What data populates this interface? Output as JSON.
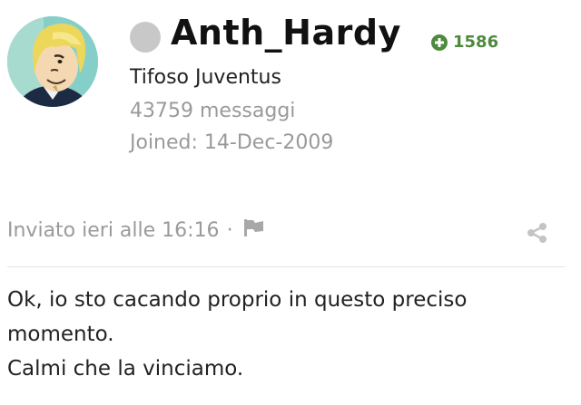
{
  "author": {
    "username": "Anth_Hardy",
    "reputation": "1586",
    "title": "Tifoso Juventus",
    "post_count": "43759 messaggi",
    "joined": "Joined: 14-Dec-2009",
    "avatar_icon": "avatar-image",
    "status_icon": "offline-status-icon",
    "reputation_icon": "plus-circle-icon"
  },
  "post": {
    "sent_text": "Inviato ieri alle 16:16",
    "separator": "·",
    "report_icon": "flag-icon",
    "share_icon": "share-icon",
    "body": [
      "Ok, io sto cacando proprio in questo preciso momento.",
      "Calmi che la vinciamo."
    ]
  },
  "colors": {
    "reputation": "#4d8a3e",
    "muted_text": "#9a9a9a",
    "status_offline": "#c8c8c8"
  }
}
